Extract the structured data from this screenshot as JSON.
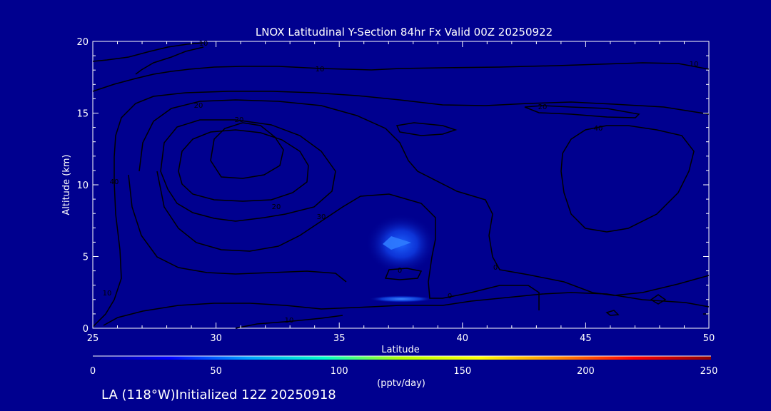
{
  "chart_data": {
    "type": "contour",
    "title": "LNOX Latitudinal Y-Section 84hr  Fx Valid 00Z 20250922",
    "xlabel": "Latitude",
    "ylabel": "Altitude (km)",
    "xlim": [
      25,
      50
    ],
    "ylim": [
      0,
      20
    ],
    "x_ticks": [
      "25",
      "30",
      "35",
      "40",
      "45",
      "50"
    ],
    "y_ticks": [
      "0",
      "5",
      "10",
      "15",
      "20"
    ],
    "background_color": "#00008f",
    "contour_line_color": "#000000",
    "contour_labels": [
      "10",
      "10",
      "20",
      "20",
      "20",
      "30",
      "40",
      "10",
      "10",
      "20",
      "40",
      "0",
      "0",
      "0",
      "10"
    ],
    "shaded_regions": [
      {
        "lat": 37.0,
        "alt": 5.9,
        "value": 45
      },
      {
        "lat": 37.3,
        "alt": 2.0,
        "value": 40
      }
    ],
    "colorbar": {
      "min": 0,
      "max": 250,
      "ticks": [
        "0",
        "50",
        "100",
        "150",
        "200",
        "250"
      ],
      "label": "(pptv/day)",
      "colors": [
        "#00008f",
        "#0000ff",
        "#00a0ff",
        "#00ffc8",
        "#b4ff00",
        "#ffff00",
        "#ff8c00",
        "#ff0000",
        "#8b0000"
      ]
    }
  },
  "footer": {
    "text": "LA (118°W)Initialized 12Z 20250918"
  }
}
